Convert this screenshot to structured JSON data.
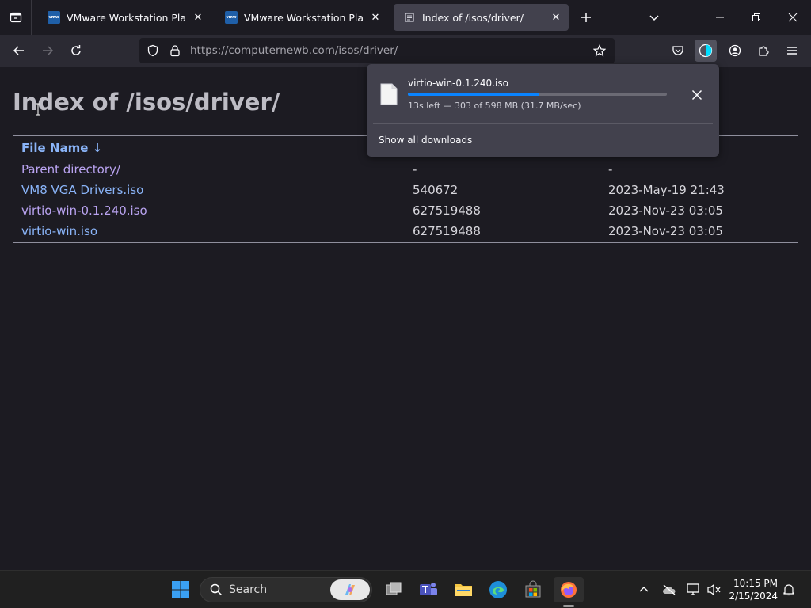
{
  "tabs": [
    {
      "title": "VMware Workstation Player | VM",
      "favicon": "vmware-icon",
      "active": false
    },
    {
      "title": "VMware Workstation Player - VM",
      "favicon": "vmware-icon",
      "active": false
    },
    {
      "title": "Index of /isos/driver/",
      "favicon": "page-icon",
      "active": true
    }
  ],
  "vmware_favicon_text": "vmw",
  "navbar": {
    "url_host": "https://computernewb.com",
    "url_path": "/isos/driver/"
  },
  "page": {
    "heading": "Index of /isos/driver/",
    "column_filename": "File Name  ↓",
    "rows": [
      {
        "name": "Parent directory/",
        "size": "-",
        "date": "-"
      },
      {
        "name": "VM8 VGA Drivers.iso",
        "size": "540672",
        "date": "2023-May-19 21:43"
      },
      {
        "name": "virtio-win-0.1.240.iso",
        "size": "627519488",
        "date": "2023-Nov-23 03:05"
      },
      {
        "name": "virtio-win.iso",
        "size": "627519488",
        "date": "2023-Nov-23 03:05"
      }
    ]
  },
  "download": {
    "filename": "virtio-win-0.1.240.iso",
    "status": "13s left — 303 of 598 MB (31.7 MB/sec)",
    "progress_fraction": 0.507,
    "show_all": "Show all downloads"
  },
  "taskbar": {
    "search_label": "Search",
    "time": "10:15 PM",
    "date": "2/15/2024"
  },
  "colors": {
    "accent": "#0a84ff",
    "link": "#8ab4f8",
    "tab_active": "#42414d",
    "chrome": "#2b2a33"
  }
}
